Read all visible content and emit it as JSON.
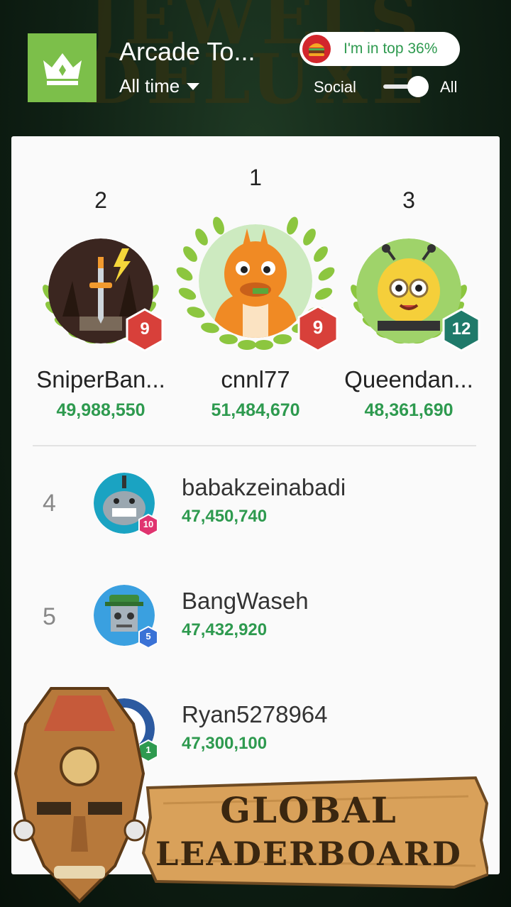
{
  "background": {
    "game_title": "JEWELS DELUXE"
  },
  "header": {
    "title": "Arcade To...",
    "period": "All time",
    "rank_pill": "I'm in top 36%",
    "segment_social": "Social",
    "segment_all": "All",
    "toggle_on": true
  },
  "podium": [
    {
      "rank": "2",
      "name": "SniperBan...",
      "score": "49,988,550",
      "level": "9",
      "badge_color": "#d8403a",
      "avatar": "sword-lightning-avatar"
    },
    {
      "rank": "1",
      "name": "cnnl77",
      "score": "51,484,670",
      "level": "9",
      "badge_color": "#d8403a",
      "avatar": "orange-dragon-avatar"
    },
    {
      "rank": "3",
      "name": "Queendan...",
      "score": "48,361,690",
      "level": "12",
      "badge_color": "#1f7a6a",
      "avatar": "bee-avatar"
    }
  ],
  "rows": [
    {
      "rank": "4",
      "name": "babakzeinabadi",
      "score": "47,450,740",
      "level": "10",
      "badge_color": "#e0336f",
      "avatar": "shark-avatar"
    },
    {
      "rank": "5",
      "name": "BangWaseh",
      "score": "47,432,920",
      "level": "5",
      "badge_color": "#3a72d6",
      "avatar": "robot-avatar"
    },
    {
      "rank": "",
      "name": "Ryan5278964",
      "score": "47,300,100",
      "level": "1",
      "badge_color": "#2e9a4f",
      "avatar": "player-avatar"
    }
  ],
  "banner": {
    "line1": "GLOBAL",
    "line2": "LEADERBOARD"
  }
}
